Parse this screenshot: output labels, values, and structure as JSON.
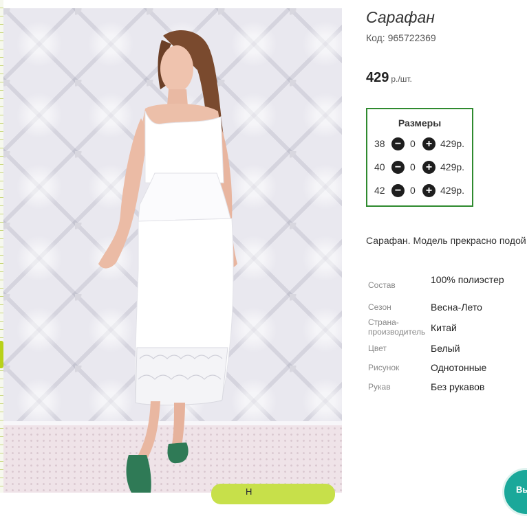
{
  "product": {
    "title": "Сарафан",
    "code": "Код: 965722369",
    "price": {
      "value": "429",
      "unit": "р./шт."
    }
  },
  "sizes": {
    "heading": "Размеры",
    "rows": [
      {
        "size": "38",
        "qty": "0",
        "price": "429р."
      },
      {
        "size": "40",
        "qty": "0",
        "price": "429р."
      },
      {
        "size": "42",
        "qty": "0",
        "price": "429р."
      }
    ]
  },
  "description": "Сарафан. Модель прекрасно подой",
  "attributes": [
    {
      "key": "Состав",
      "value": "100% полиэстер"
    },
    {
      "key": "Сезон",
      "value": "Весна-Лето"
    },
    {
      "key": "Страна-производитель",
      "value": "Китай"
    },
    {
      "key": "Цвет",
      "value": "Белый"
    },
    {
      "key": "Рисунок",
      "value": "Однотонные"
    },
    {
      "key": "Рукав",
      "value": "Без рукавов"
    }
  ],
  "cart_button": {
    "label": "Н"
  },
  "chat_button": {
    "label": "Вы"
  },
  "icons": {
    "minus": "minus-circle-icon",
    "plus": "plus-circle-icon"
  },
  "colors": {
    "frame": "#2f8a2f",
    "accent": "#c7e04a",
    "chat": "#1aa89a"
  }
}
